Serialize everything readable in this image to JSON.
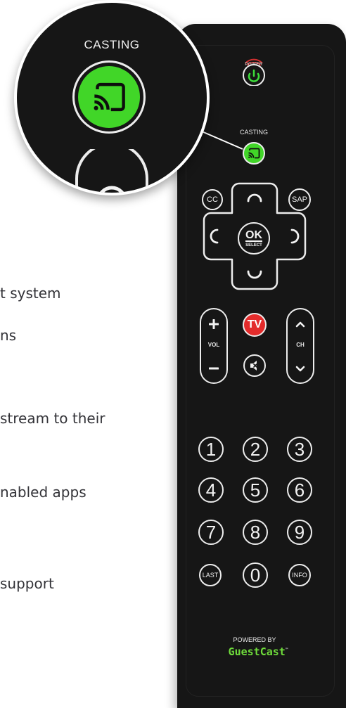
{
  "feature_lines": [
    "t system",
    "ns",
    "stream to their",
    "nabled apps",
    "support"
  ],
  "zoom": {
    "casting_label": "CASTING"
  },
  "remote": {
    "power_label": "POWER",
    "casting_label": "CASTING",
    "cc_label": "CC",
    "sap_label": "SAP",
    "ok_label": "OK",
    "select_label": "SELECT",
    "vol_label": "VOL",
    "ch_label": "CH",
    "tv_label": "TV",
    "numbers": [
      "1",
      "2",
      "3",
      "4",
      "5",
      "6",
      "7",
      "8",
      "9"
    ],
    "last_label": "LAST",
    "zero_label": "0",
    "info_label": "INFO",
    "powered_by": "POWERED BY",
    "brand": "GuestCast",
    "brand_tm": "™"
  },
  "colors": {
    "cast_green": "#41d628",
    "tv_red": "#e32b2b",
    "power_green": "#3ddc3a",
    "brand_green": "#6fdc3b"
  },
  "icons": [
    "power-icon",
    "cast-icon",
    "plus-icon",
    "minus-icon",
    "chevron-up-icon",
    "chevron-down-icon",
    "mute-icon"
  ]
}
